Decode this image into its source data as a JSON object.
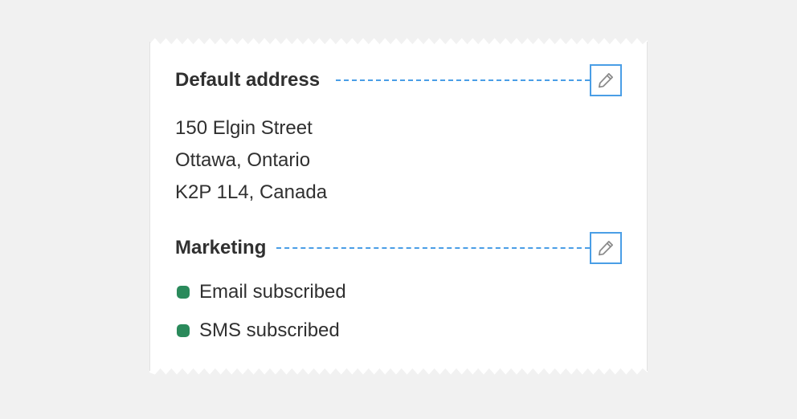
{
  "address": {
    "title": "Default address",
    "lines": [
      "150 Elgin Street",
      "Ottawa, Ontario",
      "K2P 1L4, Canada"
    ]
  },
  "marketing": {
    "title": "Marketing",
    "statuses": [
      {
        "label": "Email subscribed",
        "color": "#2a8a5b"
      },
      {
        "label": "SMS subscribed",
        "color": "#2a8a5b"
      }
    ]
  },
  "icons": {
    "edit": "pencil-icon"
  },
  "colors": {
    "accent": "#4a9ee6",
    "text": "#303030",
    "subscribed": "#2a8a5b"
  }
}
